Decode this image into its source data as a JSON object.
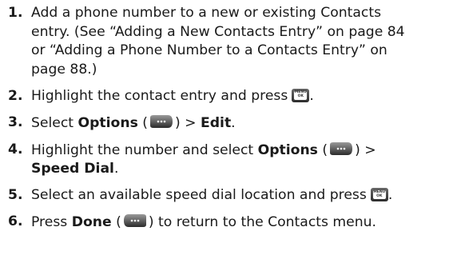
{
  "steps": [
    {
      "number": "1.",
      "lines": [
        "Add a phone number to a new or existing Contacts",
        "entry. (See “Adding a New Contacts Entry” on page 84",
        "or “Adding a Phone Number to a Contacts Entry” on",
        "page 88.)"
      ]
    },
    {
      "number": "2.",
      "text": "Highlight the contact entry and press",
      "after": "."
    },
    {
      "number": "3.",
      "prefix": "Select ",
      "options_label": "Options",
      "open_paren": " (",
      "close_paren": ") > ",
      "edit_label": "Edit",
      "end": "."
    },
    {
      "number": "4.",
      "prefix": "Highlight the number and select ",
      "options_label": "Options",
      "open_paren": " (",
      "close_paren": ") >",
      "speed_dial_label": "Speed Dial",
      "end": "."
    },
    {
      "number": "5.",
      "text": "Select an available speed dial location and press",
      "after": "."
    },
    {
      "number": "6.",
      "prefix": "Press ",
      "done_label": "Done",
      "open_paren": " (",
      "close_paren": ") to return to the Contacts menu."
    }
  ],
  "keys": {
    "menu_ok_line1": "MENU",
    "menu_ok_line2": "OK"
  },
  "colors": {
    "text": "#1a1a1a",
    "key_dark": "#2c2c2c",
    "key_light": "#8a8a8a"
  }
}
